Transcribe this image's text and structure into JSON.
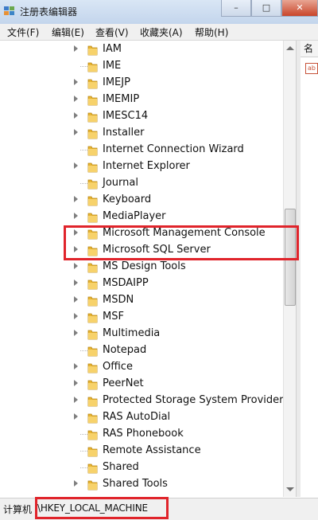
{
  "window": {
    "title": "注册表编辑器",
    "app_icon": "registry-editor-icon",
    "controls": [
      "minimize-icon",
      "maximize-icon",
      "close-icon"
    ]
  },
  "menubar": {
    "items": [
      "文件(F)",
      "编辑(E)",
      "查看(V)",
      "收藏夹(A)",
      "帮助(H)"
    ]
  },
  "tree": {
    "items": [
      {
        "label": "IAM",
        "expandable": true
      },
      {
        "label": "IME",
        "expandable": false
      },
      {
        "label": "IMEJP",
        "expandable": true
      },
      {
        "label": "IMEMIP",
        "expandable": true
      },
      {
        "label": "IMESC14",
        "expandable": true
      },
      {
        "label": "Installer",
        "expandable": true
      },
      {
        "label": "Internet Connection Wizard",
        "expandable": false
      },
      {
        "label": "Internet Explorer",
        "expandable": true
      },
      {
        "label": "Journal",
        "expandable": false
      },
      {
        "label": "Keyboard",
        "expandable": true
      },
      {
        "label": "MediaPlayer",
        "expandable": true
      },
      {
        "label": "Microsoft Management Console",
        "expandable": true
      },
      {
        "label": "Microsoft SQL Server",
        "expandable": true
      },
      {
        "label": "MS Design Tools",
        "expandable": true
      },
      {
        "label": "MSDAIPP",
        "expandable": true
      },
      {
        "label": "MSDN",
        "expandable": true
      },
      {
        "label": "MSF",
        "expandable": true
      },
      {
        "label": "Multimedia",
        "expandable": true
      },
      {
        "label": "Notepad",
        "expandable": false
      },
      {
        "label": "Office",
        "expandable": true
      },
      {
        "label": "PeerNet",
        "expandable": true
      },
      {
        "label": "Protected Storage System Provider",
        "expandable": true
      },
      {
        "label": "RAS AutoDial",
        "expandable": true
      },
      {
        "label": "RAS Phonebook",
        "expandable": false
      },
      {
        "label": "Remote Assistance",
        "expandable": false
      },
      {
        "label": "Shared",
        "expandable": false
      },
      {
        "label": "Shared Tools",
        "expandable": true
      }
    ],
    "folder_icon": "folder-icon",
    "expander_icon": "expand-arrow-icon"
  },
  "right_pane": {
    "column_header": "名",
    "value_icon": "string-value-icon"
  },
  "statusbar": {
    "label": "计算机",
    "path": "\\HKEY_LOCAL_MACHINE"
  },
  "highlight_color": "#e0242b"
}
